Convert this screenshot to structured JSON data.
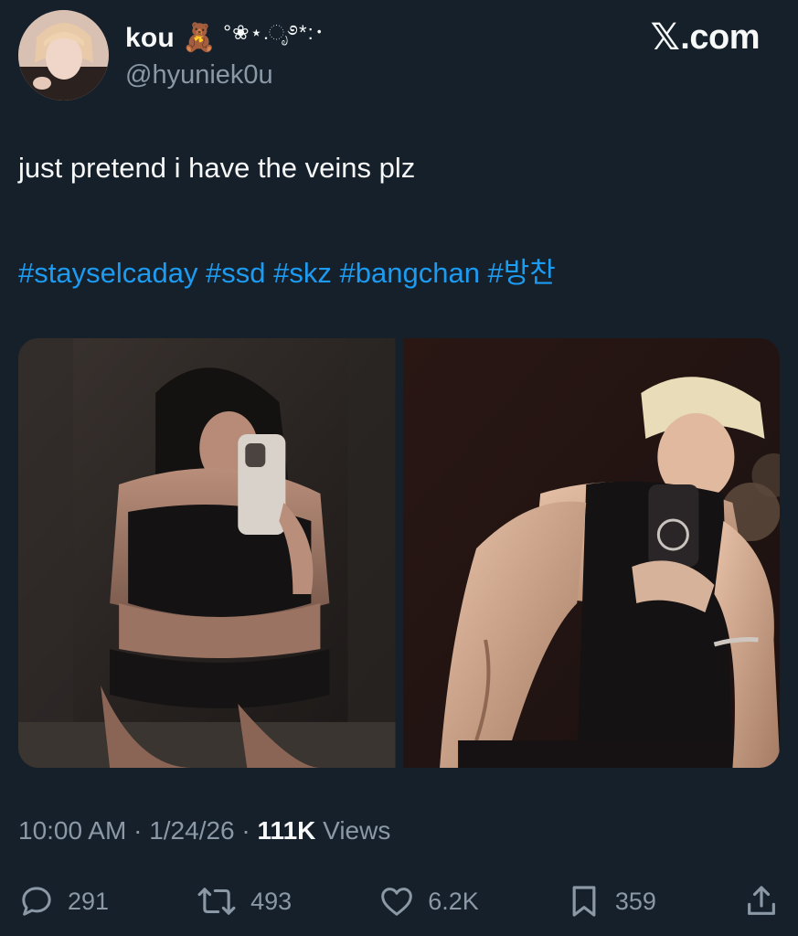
{
  "author": {
    "display_name": "kou",
    "name_emoji": "🧸",
    "name_decoration": "°❀⋆.ೃ࿔*:･",
    "handle": "@hyuniek0u"
  },
  "brand": {
    "logo_letter": "𝕏",
    "logo_suffix": ".com"
  },
  "tweet": {
    "text": "just pretend i have the veins plz",
    "hashtags": "#stayselcaday #ssd #skz #bangchan #방찬"
  },
  "meta": {
    "time": "10:00 AM",
    "sep1": "·",
    "date": "1/24/26",
    "sep2": "·",
    "views_count": "111K",
    "views_label": "Views"
  },
  "actions": {
    "replies": "291",
    "reposts": "493",
    "likes": "6.2K",
    "bookmarks": "359"
  },
  "icons": {
    "reply": "reply-icon",
    "repost": "repost-icon",
    "like": "heart-icon",
    "bookmark": "bookmark-icon",
    "share": "share-icon"
  },
  "colors": {
    "background": "#15202b",
    "text": "#f7f9f9",
    "muted": "#8b98a5",
    "link": "#1d9bf0"
  }
}
